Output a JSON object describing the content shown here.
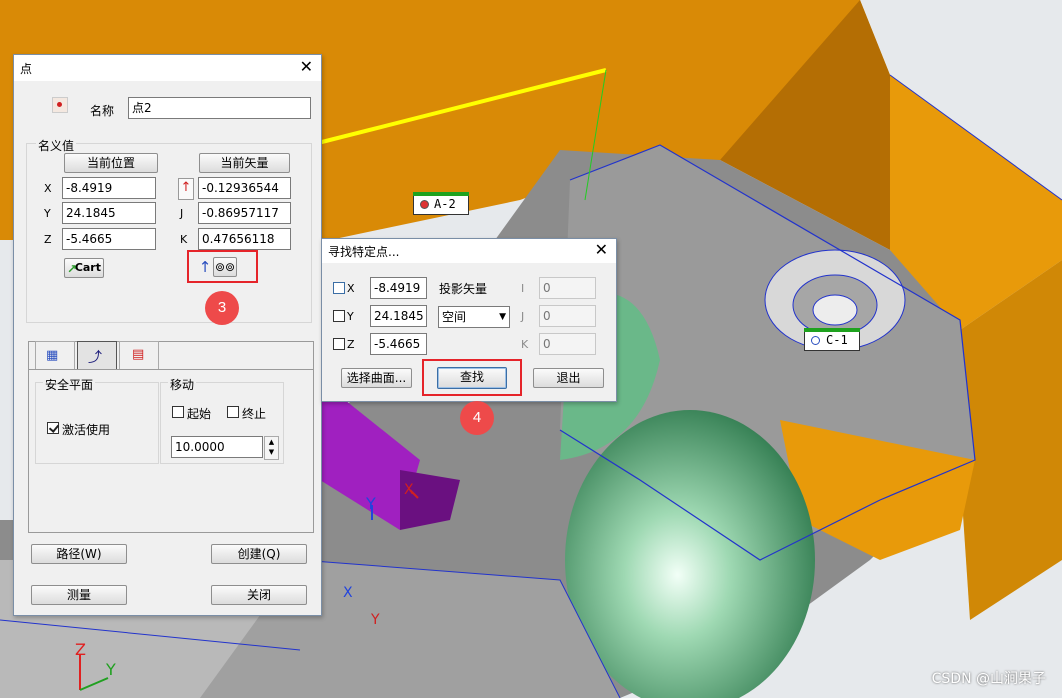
{
  "viewport": {
    "tags": {
      "a2": "A-2",
      "c1": "C-1"
    },
    "axis_labels": {
      "z": "Z",
      "y": "Y",
      "x": "X"
    },
    "watermark": "CSDN @山涧果子",
    "colors": {
      "orange": "#E89A0A",
      "gray": "#8f8f8f",
      "green": "#6ab889",
      "purple": "#a020c0",
      "yellow": "#ffff00"
    }
  },
  "point_dialog": {
    "title": "点",
    "name_label": "名称",
    "name_value": "点2",
    "nominal_group": "名义值",
    "current_position_button": "当前位置",
    "current_vector_button": "当前矢量",
    "x_label": "X",
    "y_label": "Y",
    "z_label": "Z",
    "x_value": "-8.4919",
    "y_value": "24.1845",
    "z_value": "-5.4665",
    "i_label": "I",
    "j_label": "J",
    "k_label": "K",
    "i_value": "-0.12936544",
    "j_value": "-0.86957117",
    "k_value": "0.47656118",
    "cart_button": "Cart",
    "safety_plane_group": "安全平面",
    "activate_label": "激活使用",
    "activate_checked": true,
    "move_group": "移动",
    "start_label": "起始",
    "end_label": "终止",
    "move_value": "10.0000",
    "path_button": "路径(W)",
    "create_button": "创建(Q)",
    "measure_button": "测量",
    "close_button": "关闭",
    "step_badge": "3"
  },
  "find_dialog": {
    "title": "寻找特定点...",
    "x_label": "X",
    "y_label": "Y",
    "z_label": "Z",
    "x_value": "-8.4919",
    "y_value": "24.1845",
    "z_value": "-5.4665",
    "projection_label": "投影矢量",
    "projection_value": "空间",
    "i_label": "I",
    "j_label": "J",
    "k_label": "K",
    "i_value": "0",
    "j_value": "0",
    "k_value": "0",
    "select_surface_button": "选择曲面...",
    "find_button": "查找",
    "exit_button": "退出",
    "step_badge": "4"
  }
}
